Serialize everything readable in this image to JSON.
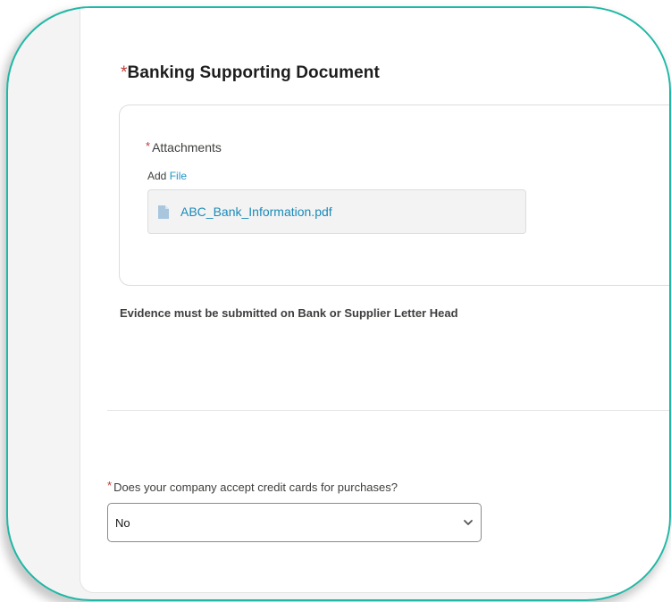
{
  "section": {
    "required_mark": "*",
    "title": "Banking Supporting Document"
  },
  "attachments": {
    "required_mark": "*",
    "label": "Attachments",
    "add_text": "Add",
    "add_link": "File",
    "files": [
      {
        "name": "ABC_Bank_Information.pdf",
        "icon": "document-icon"
      }
    ]
  },
  "evidence_note": "Evidence must be submitted on Bank or Supplier Letter Head",
  "credit_card_question": {
    "required_mark": "*",
    "label": "Does your company accept credit cards for purchases?",
    "selected": "No",
    "icon": "chevron-down-icon"
  },
  "colors": {
    "frame_accent": "#1fb8a5",
    "link": "#1b96c8",
    "required": "#c23934"
  }
}
